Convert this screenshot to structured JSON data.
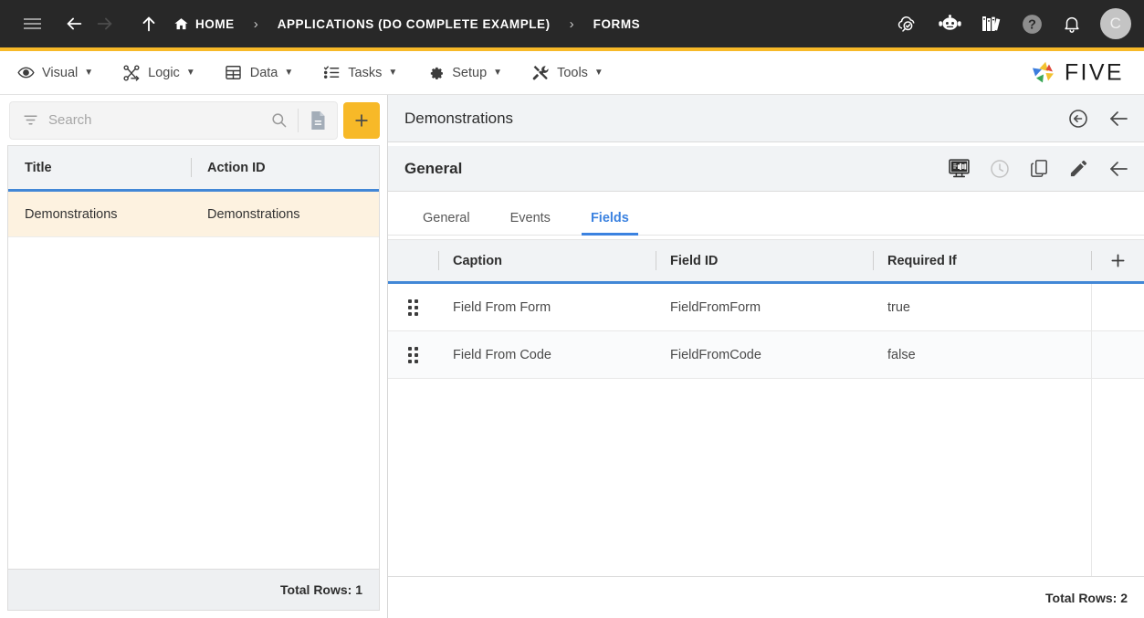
{
  "topbar": {
    "nav": {
      "menu_icon": "hamburger-icon",
      "back_icon": "arrow-left-icon",
      "forward_icon": "arrow-right-icon",
      "up_icon": "arrow-up-icon"
    },
    "breadcrumbs": [
      {
        "label": "HOME",
        "icon": "home-icon"
      },
      {
        "label": "APPLICATIONS (DO COMPLETE EXAMPLE)"
      },
      {
        "label": "FORMS"
      }
    ],
    "separator": "›",
    "right_icons": [
      "cloud-check-icon",
      "chat-bot-icon",
      "books-icon",
      "help-icon",
      "bell-icon"
    ],
    "avatar_initial": "C",
    "accent_color": "#F7B928",
    "background_color": "#282828"
  },
  "menubar": {
    "items": [
      {
        "label": "Visual",
        "icon": "eye-icon",
        "caret": "▼"
      },
      {
        "label": "Logic",
        "icon": "logic-nodes-icon",
        "caret": "▼"
      },
      {
        "label": "Data",
        "icon": "grid-table-icon",
        "caret": "▼"
      },
      {
        "label": "Tasks",
        "icon": "checklist-icon",
        "caret": "▼"
      },
      {
        "label": "Setup",
        "icon": "gear-icon",
        "caret": "▼"
      },
      {
        "label": "Tools",
        "icon": "tools-icon",
        "caret": "▼"
      }
    ],
    "logo_text": "FIVE"
  },
  "left_panel": {
    "search": {
      "placeholder": "Search",
      "value": "",
      "filter_icon": "filter-icon",
      "search_icon": "search-icon",
      "document_icon": "document-icon",
      "add_label": "+"
    },
    "table": {
      "columns": [
        "Title",
        "Action ID"
      ],
      "rows": [
        {
          "title": "Demonstrations",
          "action_id": "Demonstrations",
          "selected": true
        }
      ]
    },
    "footer": "Total Rows: 1"
  },
  "right_panel": {
    "header": {
      "title": "Demonstrations",
      "actions": [
        "undo-circle-icon",
        "arrow-left-icon"
      ]
    },
    "subheader": {
      "title": "General",
      "actions": [
        "monitor-preview-icon",
        "history-clock-icon",
        "copy-icon",
        "edit-pencil-icon",
        "arrow-left-icon"
      ]
    },
    "tabs": [
      {
        "label": "General",
        "active": false
      },
      {
        "label": "Events",
        "active": false
      },
      {
        "label": "Fields",
        "active": true
      }
    ],
    "fields_table": {
      "columns": [
        "Caption",
        "Field ID",
        "Required If"
      ],
      "add_label": "+",
      "rows": [
        {
          "handle": "drag-handle-icon",
          "caption": "Field From Form",
          "field_id": "FieldFromForm",
          "required_if": "true"
        },
        {
          "handle": "drag-handle-icon",
          "caption": "Field From Code",
          "field_id": "FieldFromCode",
          "required_if": "false"
        }
      ]
    },
    "footer": "Total Rows: 2"
  },
  "colors": {
    "accent_yellow": "#F7B928",
    "accent_blue": "#4287d6",
    "tab_active_blue": "#3b82e0",
    "selected_row": "#fdf2e0",
    "header_grey": "#f1f3f5",
    "dark_bar": "#282828"
  }
}
